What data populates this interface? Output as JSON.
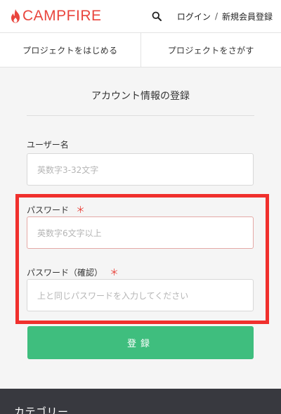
{
  "header": {
    "logo_text": "CAMPFIRE",
    "logo_icon": "flame-icon",
    "search_icon": "search-icon",
    "login_label": "ログイン",
    "separator": "/",
    "register_label": "新規会員登録"
  },
  "tabs": [
    {
      "label": "プロジェクトをはじめる"
    },
    {
      "label": "プロジェクトをさがす"
    }
  ],
  "form": {
    "title": "アカウント情報の登録",
    "username": {
      "label": "ユーザー名",
      "placeholder": "英数字3-32文字"
    },
    "password": {
      "label": "パスワード",
      "required_mark": "＊",
      "placeholder": "英数字6文字以上"
    },
    "password_confirm": {
      "label": "パスワード（確認）",
      "required_mark": "＊",
      "placeholder": "上と同じパスワードを入力してください"
    },
    "submit_label": "登録"
  },
  "footer": {
    "category_title": "カテゴリー"
  },
  "colors": {
    "brand_red": "#e9453d",
    "submit_green": "#3fbe7e",
    "highlight_red": "#f0302d",
    "footer_bg": "#38393f"
  }
}
